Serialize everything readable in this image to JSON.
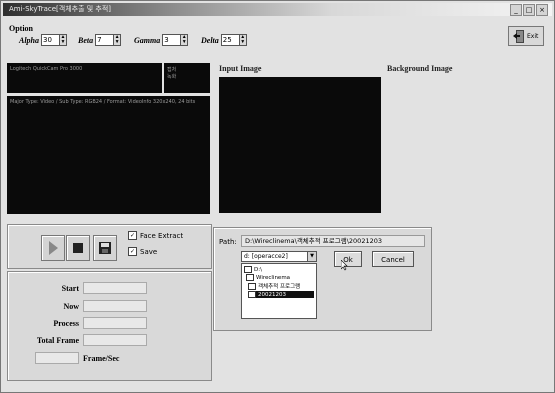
{
  "window": {
    "title": "Ami-SkyTrace[객체추출 및 추적]",
    "controls": [
      "_",
      "□",
      "×"
    ]
  },
  "options": {
    "title": "Option",
    "params": [
      {
        "label": "Alpha",
        "value": "30"
      },
      {
        "label": "Beta",
        "value": "7"
      },
      {
        "label": "Gamma",
        "value": "3"
      },
      {
        "label": "Delta",
        "value": "25"
      }
    ]
  },
  "exit_button": {
    "label": "Exit"
  },
  "camera": {
    "device": "Logitech QuickCam Pro 3000",
    "small_info": "캡처 녹화",
    "format_info": "Major Type: Video / Sub Type: RGB24 / Format: VideoInfo 320x240, 24 bits"
  },
  "input_image": {
    "title": "Input Image"
  },
  "background_image": {
    "title": "Background Image"
  },
  "checkboxes": [
    {
      "label": "Face Extract",
      "checked": true
    },
    {
      "label": "Save",
      "checked": true
    }
  ],
  "stats": {
    "start": "Start",
    "now": "Now",
    "process": "Process",
    "total_frame": "Total Frame",
    "frame_sec": "Frame/Sec"
  },
  "path": {
    "label": "Path:",
    "value": "D:\\Wireclinema\\객체추적 프로그램\\20021203",
    "drive": "d: [operacce2]",
    "dirs": [
      {
        "name": "D:\\",
        "selected": false
      },
      {
        "name": "Wireclinema",
        "selected": false
      },
      {
        "name": "객체추적 프로그램",
        "selected": false
      },
      {
        "name": "20021203",
        "selected": true
      }
    ]
  },
  "buttons": {
    "ok": "Ok",
    "cancel": "Cancel"
  }
}
